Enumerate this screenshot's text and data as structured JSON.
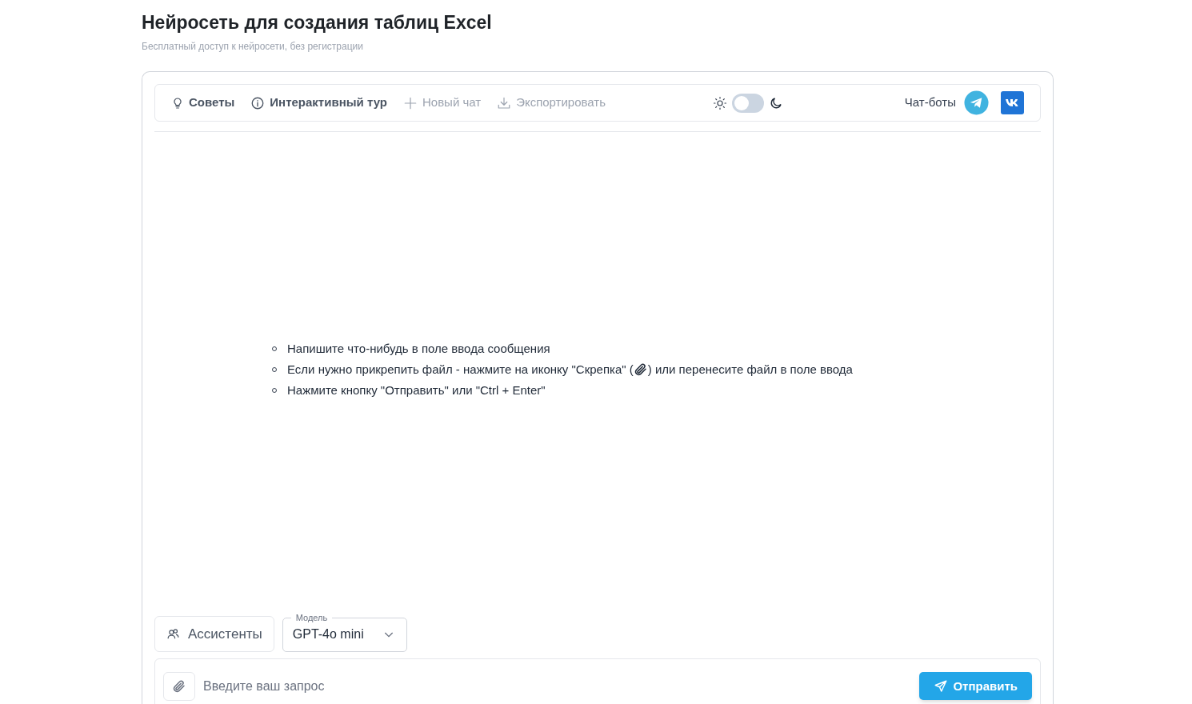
{
  "header": {
    "title": "Нейросеть для создания таблиц Excel",
    "subtitle": "Бесплатный доступ к нейросети, без регистрации"
  },
  "toolbar": {
    "actions": [
      {
        "kind": "bulb",
        "label": "Советы",
        "disabled": false
      },
      {
        "kind": "info",
        "label": "Интерактивный тур",
        "disabled": false
      },
      {
        "kind": "plus",
        "label": "Новый чат",
        "disabled": true
      },
      {
        "kind": "download",
        "label": "Экспортировать",
        "disabled": true
      }
    ],
    "dark_mode": {
      "on": false
    },
    "bots_label": "Чат-боты"
  },
  "hints": [
    {
      "text": "Напишите что-нибудь в поле ввода сообщения"
    },
    {
      "text": "Если нужно прикрепить файл - нажмите на иконку \"Скрепка\" (",
      "kind": "with_icon",
      "text_after": ") или перенесите файл в поле ввода"
    },
    {
      "text": "Нажмите кнопку \"Отправить\" или \"Ctrl + Enter\""
    }
  ],
  "assistants_button": "Ассистенты",
  "model_select": {
    "label": "Модель",
    "value": "GPT-4o mini"
  },
  "composer": {
    "placeholder": "Введите ваш запрос",
    "send_button": "Отправить"
  }
}
